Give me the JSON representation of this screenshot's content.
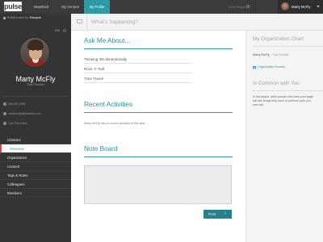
{
  "topbar": {
    "logo": "pulse",
    "nav": [
      "Newsfeed",
      "My Content",
      "My Profile"
    ],
    "active_nav": "My Profile",
    "find_people": "Find People",
    "user_name": "Marty McFly"
  },
  "sidebar": {
    "visibility_label": "Profile is seen by:",
    "visibility_value": "Everyone",
    "edit_label": "Edit",
    "name": "Marty McFly",
    "title": "Time Traveler",
    "contacts": [
      {
        "icon": "phone-icon",
        "text": "555-000-1955"
      },
      {
        "icon": "mail-icon",
        "text": "marty.mcfly@hillvalley.com"
      },
      {
        "icon": "location-icon",
        "text": "Twin Pines Mall"
      }
    ],
    "menu": [
      "Libraries",
      "Overview",
      "Organization",
      "Content",
      "Tags & Notes",
      "Colleagues",
      "Members"
    ],
    "active_menu": "Overview"
  },
  "status": {
    "placeholder": "What's happening?"
  },
  "ask_me": {
    "title": "Ask Me About...",
    "tags": [
      "Thinking 4th dimentionally",
      "Rock 'n' Roll",
      "Time Travel"
    ]
  },
  "activities": {
    "title": "Recent Activities",
    "empty_text": "Marty McFly has no recent activities at this time."
  },
  "note_board": {
    "title": "Note Board",
    "post_label": "Post"
  },
  "right_panel": {
    "org_title": "My Organization Chart",
    "org_person": "Marty McFly",
    "org_person_title": "Time Traveler",
    "org_browser": "Organization Browser",
    "common_title": "In Common with You",
    "common_text": "In this space, other people who view your page will see things they have in common with you such as:"
  },
  "colors": {
    "accent": "#2e9aa6",
    "topbar": "#393b3c",
    "sidebar": "#333435",
    "active_marker": "#e0413a"
  }
}
